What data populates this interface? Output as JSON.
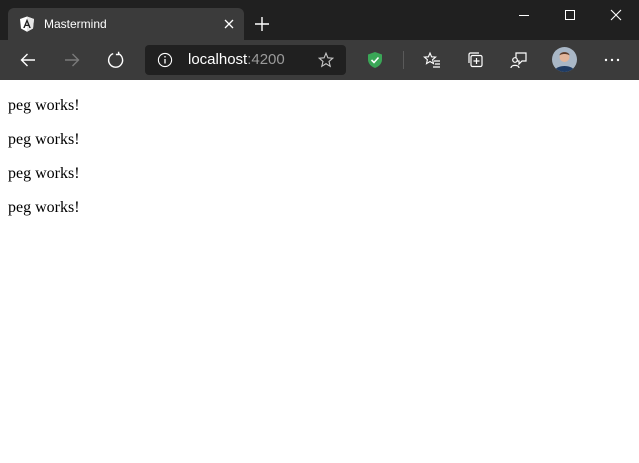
{
  "browser": {
    "tab": {
      "title": "Mastermind",
      "favicon": "angular-icon"
    },
    "address_bar": {
      "host": "localhost",
      "port": ":4200"
    },
    "toolbar_icons": [
      "back-arrow-icon",
      "forward-arrow-icon",
      "refresh-icon",
      "info-icon",
      "star-icon",
      "shield-check-icon",
      "favorites-icon",
      "collections-icon",
      "feedback-icon",
      "more-icon"
    ],
    "colors": {
      "tabstrip_bg": "#202020",
      "toolbar_bg": "#3b3b3b",
      "shield_green": "#3aa757",
      "forward_disabled": "#7a7a7a"
    }
  },
  "page": {
    "pegs": [
      {
        "text": "peg works!"
      },
      {
        "text": "peg works!"
      },
      {
        "text": "peg works!"
      },
      {
        "text": "peg works!"
      }
    ]
  }
}
